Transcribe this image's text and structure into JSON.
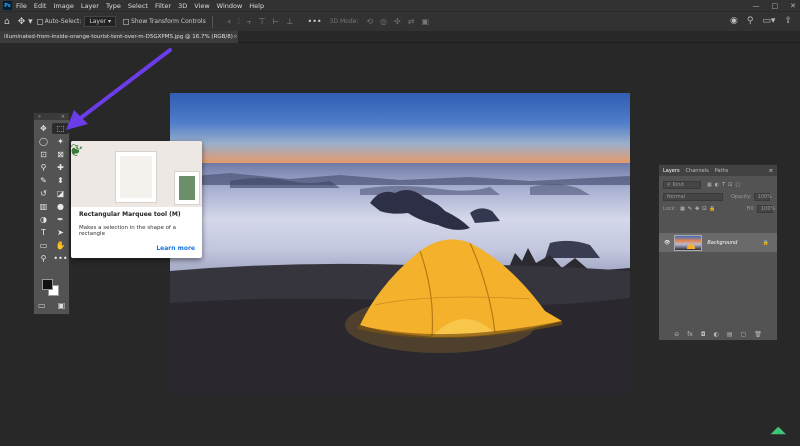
{
  "app": {
    "logo": "Ps",
    "menu": [
      "File",
      "Edit",
      "Image",
      "Layer",
      "Type",
      "Select",
      "Filter",
      "3D",
      "View",
      "Window",
      "Help"
    ],
    "window_controls": [
      "—",
      "□",
      "✕"
    ]
  },
  "options_bar": {
    "auto_select_label": "Auto-Select:",
    "auto_select_value": "Layer",
    "transform_label": "Show Transform Controls",
    "more": "•••",
    "mode_3d": "3D Mode:"
  },
  "document": {
    "tab_title": "illuminated-from-inside-orange-tourist-tent-over-m-D5GXPMS.jpg @ 16.7% (RGB/8)",
    "close": "×"
  },
  "toolbox": {
    "header_left": "»",
    "header_right": "×",
    "tools": [
      {
        "icon": "move-icon",
        "glyph": "✥"
      },
      {
        "icon": "marquee-icon",
        "glyph": "⬚"
      },
      {
        "icon": "lasso-icon",
        "glyph": "◯"
      },
      {
        "icon": "magic-wand-icon",
        "glyph": "✦"
      },
      {
        "icon": "crop-icon",
        "glyph": "⊡"
      },
      {
        "icon": "frame-icon",
        "glyph": "⊠"
      },
      {
        "icon": "eyedropper-icon",
        "glyph": "⚲"
      },
      {
        "icon": "healing-icon",
        "glyph": "✚"
      },
      {
        "icon": "brush-icon",
        "glyph": "✎"
      },
      {
        "icon": "stamp-icon",
        "glyph": "⬍"
      },
      {
        "icon": "history-brush-icon",
        "glyph": "↺"
      },
      {
        "icon": "eraser-icon",
        "glyph": "◪"
      },
      {
        "icon": "gradient-icon",
        "glyph": "▥"
      },
      {
        "icon": "blur-icon",
        "glyph": "●"
      },
      {
        "icon": "dodge-icon",
        "glyph": "◑"
      },
      {
        "icon": "pen-icon",
        "glyph": "✒"
      },
      {
        "icon": "type-icon",
        "glyph": "T"
      },
      {
        "icon": "path-selection-icon",
        "glyph": "➤"
      },
      {
        "icon": "shape-icon",
        "glyph": "▭"
      },
      {
        "icon": "hand-icon",
        "glyph": "✋"
      },
      {
        "icon": "zoom-icon",
        "glyph": "⚲"
      },
      {
        "icon": "more-tools-icon",
        "glyph": "•••"
      }
    ],
    "bottom_left": "▭",
    "bottom_right": "▣"
  },
  "tooltip": {
    "title": "Rectangular Marquee tool (M)",
    "description": "Makes a selection in the shape of a rectangle",
    "link": "Learn more"
  },
  "layers_panel": {
    "tabs": [
      "Layers",
      "Channels",
      "Paths"
    ],
    "filter_placeholder": "Kind",
    "blend_mode": "Normal",
    "opacity_label": "Opacity:",
    "opacity_value": "100%",
    "lock_label": "Lock:",
    "fill_label": "Fill:",
    "fill_value": "100%",
    "layer_name": "Background",
    "bottom_icons": [
      "⊝",
      "fx",
      "◘",
      "◐",
      "▤",
      "▢",
      "🗑"
    ]
  },
  "colors": {
    "annotation_arrow": "#6a3de8",
    "link_blue": "#1473e6",
    "tent": "#f4b12b"
  }
}
